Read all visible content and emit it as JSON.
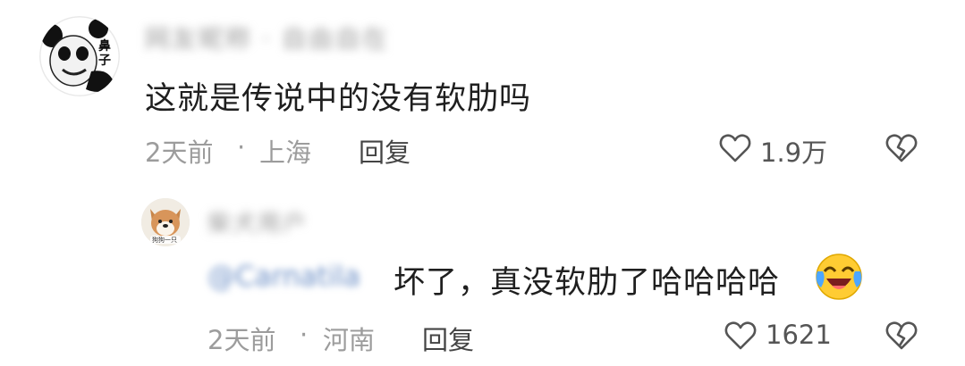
{
  "comment": {
    "username": "网友昵称 · 自由自在",
    "avatar_text": "鼻子",
    "text": "这就是传说中的没有软肋吗",
    "time": "2天前",
    "separator": "·",
    "location": "上海",
    "reply_label": "回复",
    "like_count": "1.9万",
    "like_icon": "heart-outline-icon",
    "dislike_icon": "broken-heart-icon"
  },
  "reply": {
    "username": "柴犬用户",
    "avatar_text": "狗狗一只",
    "mention": "@Carnatila",
    "text": "坏了，真没软肋了哈哈哈哈",
    "emoji": "laughing-crying-emoji",
    "time": "2天前",
    "separator": "·",
    "location": "河南",
    "reply_label": "回复",
    "like_count": "1621",
    "like_icon": "heart-outline-icon",
    "dislike_icon": "broken-heart-icon"
  }
}
